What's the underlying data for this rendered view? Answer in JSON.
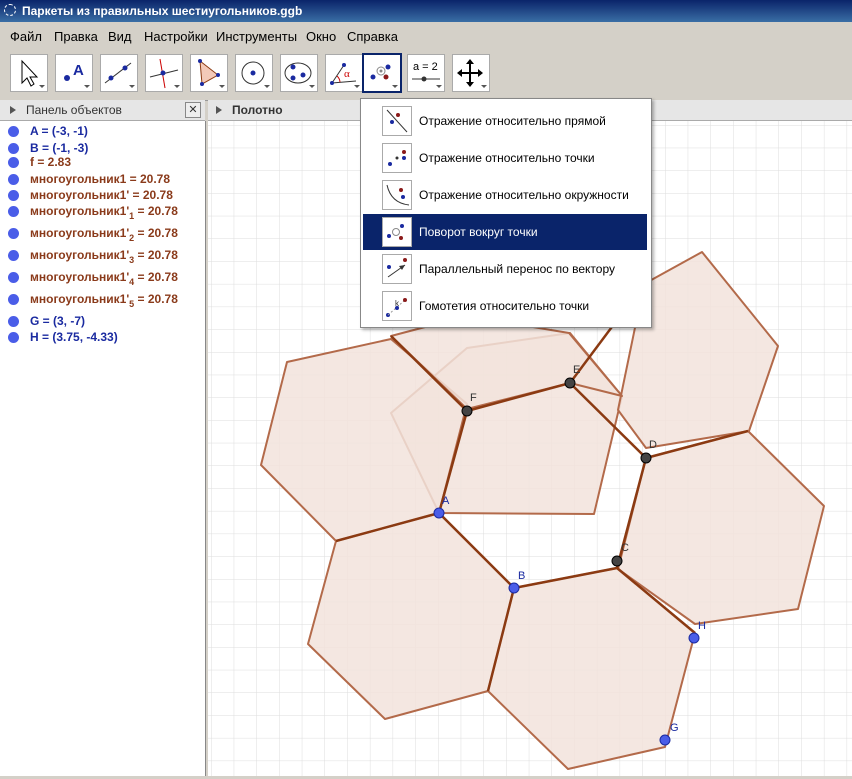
{
  "window": {
    "title": "Паркеты из правильных шестиугольников.ggb"
  },
  "menu": [
    "Файл",
    "Правка",
    "Вид",
    "Настройки",
    "Инструменты",
    "Окно",
    "Справка"
  ],
  "toolbar": {
    "tools": [
      "move-tool",
      "point-tool",
      "line-tool",
      "perpendicular-tool",
      "polygon-tool",
      "circle-tool",
      "conic-tool",
      "angle-tool",
      "transform-tool",
      "slider-tool",
      "move-view-tool"
    ],
    "slider_label": "a = 2",
    "active_tool": "transform-tool"
  },
  "objects_panel": {
    "title": "Панель объектов",
    "close": "✕",
    "items": [
      {
        "text": "A = (-3, -1)",
        "kind": "point"
      },
      {
        "text": "B = (-1, -3)",
        "kind": "point"
      },
      {
        "text": "f = 2.83",
        "kind": "number"
      },
      {
        "text": "многоугольник1 = 20.78",
        "kind": "polygon"
      },
      {
        "text": "многоугольник1' = 20.78",
        "kind": "polygon"
      },
      {
        "text": "многоугольник1'",
        "sub": "1",
        "rest": " = 20.78",
        "kind": "polygon"
      },
      {
        "text": "многоугольник1'",
        "sub": "2",
        "rest": " = 20.78",
        "kind": "polygon"
      },
      {
        "text": "многоугольник1'",
        "sub": "3",
        "rest": " = 20.78",
        "kind": "polygon"
      },
      {
        "text": "многоугольник1'",
        "sub": "4",
        "rest": " = 20.78",
        "kind": "polygon"
      },
      {
        "text": "многоугольник1'",
        "sub": "5",
        "rest": " = 20.78",
        "kind": "polygon"
      },
      {
        "text": "G = (3, -7)",
        "kind": "point"
      },
      {
        "text": "H = (3.75, -4.33)",
        "kind": "point"
      }
    ]
  },
  "canvas": {
    "title": "Полотно",
    "point_labels": [
      "A",
      "B",
      "C",
      "D",
      "E",
      "F",
      "G",
      "H"
    ],
    "colors": {
      "fill": "#f2e3dc",
      "edge": "#b36a4a",
      "edge_bold": "#8b3a12",
      "free_point": "#4a5de8",
      "dependent_point": "#444444",
      "grid": "#dddddd"
    }
  },
  "transform_menu": {
    "items": [
      {
        "label": "Отражение относительно прямой",
        "icon": "reflect-line-icon"
      },
      {
        "label": "Отражение относительно точки",
        "icon": "reflect-point-icon"
      },
      {
        "label": "Отражение относительно окружности",
        "icon": "reflect-circle-icon"
      },
      {
        "label": "Поворот вокруг точки",
        "icon": "rotate-icon",
        "selected": true
      },
      {
        "label": "Параллельный перенос по вектору",
        "icon": "translate-icon"
      },
      {
        "label": "Гомотетия относительно точки",
        "icon": "dilate-icon"
      }
    ]
  }
}
